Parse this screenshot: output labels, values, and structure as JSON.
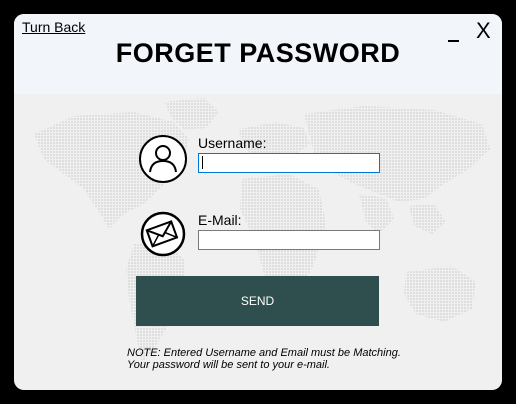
{
  "window": {
    "title": "FORGET PASSWORD",
    "back_link": "Turn Back",
    "close_glyph": "X"
  },
  "form": {
    "username_label": "Username:",
    "username_value": "",
    "email_label": "E-Mail:",
    "email_value": "",
    "send_label": "SEND"
  },
  "note": {
    "line1": "NOTE: Entered Username and Email must be Matching.",
    "line2": "Your password will be sent to your e-mail."
  },
  "icons": {
    "user": "user-icon",
    "envelope": "envelope-icon"
  },
  "colors": {
    "send_button": "#2f4f4f",
    "header_bg": "#f2f5fa",
    "body_bg": "#f0f0f0",
    "focus_border": "#0078d7"
  }
}
